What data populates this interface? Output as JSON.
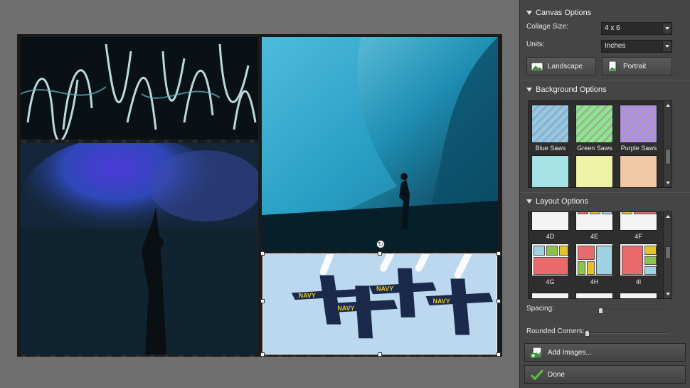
{
  "canvas_options": {
    "header": "Canvas Options",
    "collage_size_label": "Collage Size:",
    "collage_size_value": "4 x 6",
    "units_label": "Units:",
    "units_value": "Inches",
    "landscape_label": "Landscape",
    "portrait_label": "Portrait"
  },
  "background_options": {
    "header": "Background Options",
    "swatches": [
      {
        "label": "Blue Saws",
        "color": "#8ec9ec"
      },
      {
        "label": "Green Saws",
        "color": "#8ee68a"
      },
      {
        "label": "Purple Saws",
        "color": "#b38ee6"
      }
    ],
    "second_row_colors": [
      "#a7e3e6",
      "#eef2a6",
      "#f2c9a6"
    ],
    "scroll_fraction": 0.7
  },
  "layout_options": {
    "header": "Layout Options",
    "row1": [
      "4D",
      "4E",
      "4F"
    ],
    "row2": [
      "4G",
      "4H",
      "4I"
    ],
    "scroll_fraction": 0.45
  },
  "spacing": {
    "label": "Spacing:",
    "value": 0.15
  },
  "rounded_corners": {
    "label": "Rounded Corners:",
    "value": 0.0
  },
  "buttons": {
    "add_images": "Add Images...",
    "done": "Done"
  },
  "colors": {
    "layout_red": "#e96a6a",
    "layout_blue": "#9ed3e2",
    "layout_yellow": "#e6c12a",
    "layout_green": "#8cc34b"
  },
  "photo_text": {
    "jet_tail": "NAVY"
  }
}
